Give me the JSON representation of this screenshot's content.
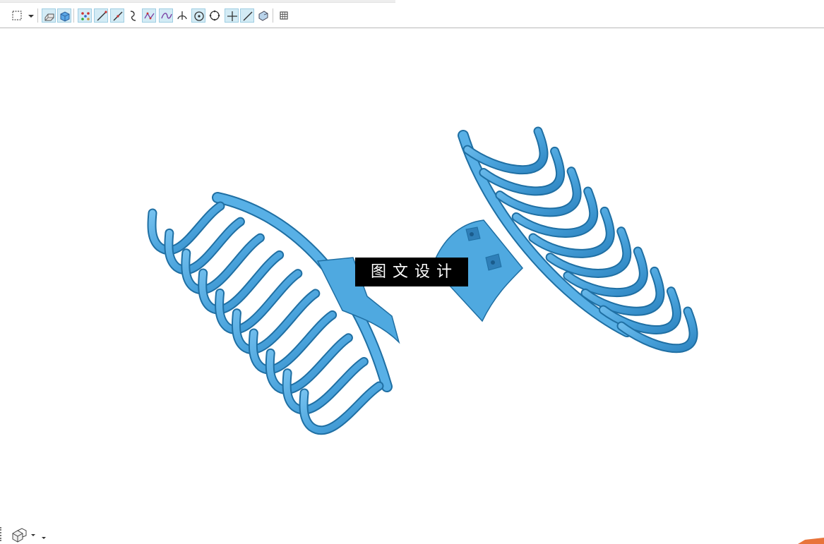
{
  "toolbar": {
    "tools": [
      {
        "icon": "box-select-icon"
      },
      {
        "icon": "dropdown-arrow-icon"
      },
      {
        "icon": "wireframe-solid-icon"
      },
      {
        "icon": "shaded-solid-icon"
      },
      {
        "icon": "point-snap-icon"
      },
      {
        "icon": "line-end-snap-icon"
      },
      {
        "icon": "line-mid-snap-icon"
      },
      {
        "icon": "curve-snap-icon"
      },
      {
        "icon": "spline-point-icon"
      },
      {
        "icon": "spline-curve-icon"
      },
      {
        "icon": "intersection-icon"
      },
      {
        "icon": "circle-center-icon"
      },
      {
        "icon": "circle-quadrant-icon"
      },
      {
        "icon": "crosshair-icon"
      },
      {
        "icon": "tangent-line-icon"
      },
      {
        "icon": "face-select-icon"
      },
      {
        "icon": "grid-icon"
      }
    ]
  },
  "viewport": {
    "watermark_text": "图文设计",
    "model_color": "#4fa9e0",
    "model_edge_color": "#1f6fa3"
  },
  "bottom_bar": {
    "icon": "view-cube-icon"
  }
}
